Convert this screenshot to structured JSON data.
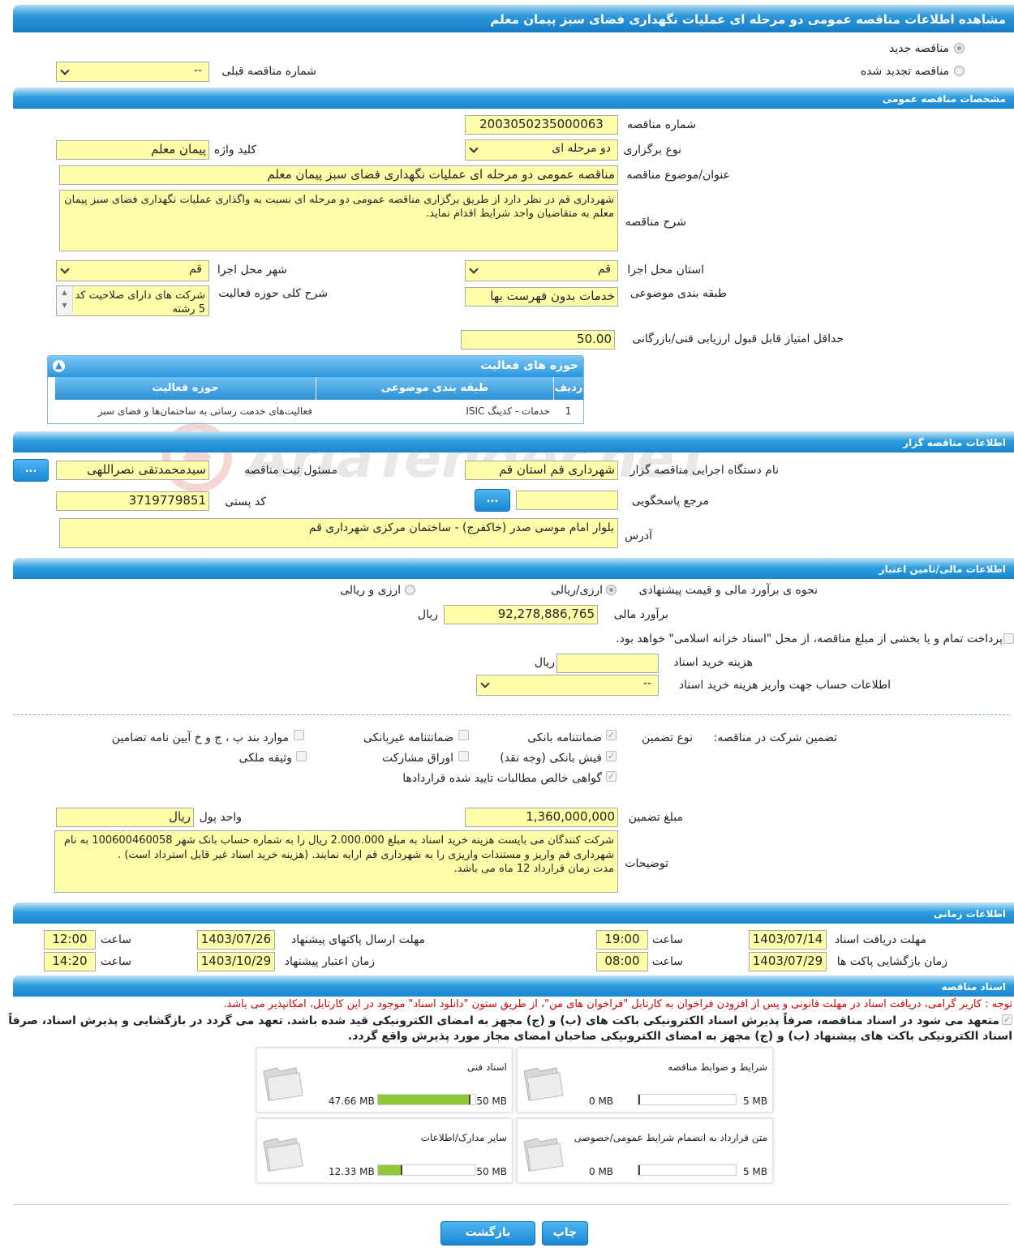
{
  "page_title": "مشاهده اطلاعات مناقصه عمومی دو مرحله ای عملیات نگهداری فضای سبز پیمان معلم",
  "tender_type": {
    "new_label": "مناقصه جدید",
    "renewed_label": "مناقصه تجدید شده",
    "previous_number_label": "شماره مناقصه قبلی",
    "previous_number_value": "--"
  },
  "general": {
    "section_title": "مشخصات مناقصه عمومی",
    "tender_number_label": "شماره مناقصه",
    "tender_number": "2003050235000063",
    "holding_type_label": "نوع برگزاری",
    "holding_type": "دو مرحله ای",
    "keyword_label": "کلید واژه",
    "keyword": "پیمان معلم",
    "subject_label": "عنوان/موضوع مناقصه",
    "subject": "مناقصه عمومی دو مرحله ای عملیات نگهداری فضای سبز پیمان معلم",
    "description_label": "شرح مناقصه",
    "description": "شهرداری قم در نظر دارد از طریق برگزاری مناقصه عمومی دو مرحله ای نسبت به واگذاری عملیات نگهداری فضای سبز پیمان معلم  به متقاضیان واجد شرایط اقدام نماید.",
    "province_label": "استان محل اجرا",
    "province": "قم",
    "city_label": "شهر محل اجرا",
    "city": "قم",
    "category_label": "طبقه بندی موضوعی",
    "category": "خدمات بدون فهرست بها",
    "activity_scope_label": "شرح کلی حوزه فعالیت",
    "activity_scope": "شرکت های دارای صلاحیت  کد 5 رشته",
    "min_score_label": "حداقل امتیاز قابل قبول ارزیابی فنی/بازرگانی",
    "min_score": "50.00"
  },
  "activity_table": {
    "title": "حوزه های فعالیت",
    "headers": [
      "ردیف",
      "طبقه بندی موضوعی",
      "حوزه فعالیت"
    ],
    "rows": [
      [
        "1",
        "خدمات - کدینگ ISIC",
        "فعالیت‌های خدمت رسانی به ساختمان‌ها و فضای سبز"
      ]
    ]
  },
  "organizer": {
    "section_title": "اطلاعات مناقصه گزار",
    "org_label": "نام دستگاه اجرایی مناقصه گزار",
    "org": "شهرداری قم استان قم",
    "registrar_label": "مسئول ثبت مناقصه",
    "registrar": "سیدمحمدتقی نصراللهی",
    "reference_label": "مرجع پاسخگویی",
    "reference": "",
    "postal_label": "کد پستی",
    "postal": "3719779851",
    "address_label": "آدرس",
    "address": "بلوار امام موسی صدر (خاکفرج) - ساختمان مرکزی شهرداری قم",
    "dots": "..."
  },
  "finance": {
    "section_title": "اطلاعات مالی/تامین اعتبار",
    "method_label": "نحوه ی برآورد مالی و قیمت پیشنهادی",
    "opt_rial": "ارزی/ریالی",
    "opt_fx": "ارزی و ریالی",
    "estimate_label": "برآورد مالی",
    "estimate": "92,278,886,765",
    "currency": "ریال",
    "treasury_text": "پرداخت تمام و یا بخشی از مبلغ مناقصه، از محل \"اسناد خزانه اسلامی\" خواهد بود.",
    "doc_cost_label": "هزینه خرید اسناد",
    "doc_cost": "",
    "doc_cost_unit": "ریال",
    "account_label": "اطلاعات حساب جهت واریز هزینه خرید اسناد",
    "account": "--"
  },
  "guarantee": {
    "title_label": "تضمین شرکت در مناقصه:",
    "type_label": "نوع تضمین",
    "options": [
      "ضمانتنامه بانکی",
      "ضمانتنامه غیربانکی",
      "موارد بند پ ، ج و خ آیین نامه تضامین",
      "فیش بانکی (وجه نقد)",
      "اوراق مشارکت",
      "وثیقه ملکی",
      "گواهی خالص مطالبات تایید شده قراردادها"
    ],
    "amount_label": "مبلغ تضمین",
    "amount": "1,360,000,000",
    "unit_label": "واحد پول",
    "unit": "ریال",
    "notes_label": "توضیحات",
    "notes": "شرکت کنندگان می بایست هزینه خرید اسناد به مبلغ 2.000.000 ریال را به شماره حساب بانک شهر 100600460058 به نام شهرداری قم واریز و مستندات واریزی را به شهرداری قم ارایه نمایند. (هزینه خرید اسناد غیر قابل استرداد است) .\nمدت زمان قرارداد 12 ماه می باشد."
  },
  "timing": {
    "section_title": "اطلاعات زمانی",
    "doc_deadline_label": "مهلت دریافت اسناد",
    "doc_deadline": "1403/07/14",
    "time_label": "ساعت",
    "doc_deadline_time": "19:00",
    "submit_deadline_label": "مهلت ارسال پاکتهای پیشنهاد",
    "submit_deadline": "1403/07/26",
    "submit_deadline_time": "12:00",
    "opening_label": "زمان بازگشایی پاکت ها",
    "opening": "1403/07/29",
    "opening_time": "08:00",
    "validity_label": "زمان اعتبار پیشنهاد",
    "validity": "1403/10/29",
    "validity_time": "14:20"
  },
  "documents": {
    "section_title": "اسناد مناقصه",
    "notice": "توجه : کاربر گرامی، دریافت اسناد در مهلت قانونی و پس از افزودن فراخوان به کارتابل \"فراخوان های من\"، از طریق ستون \"دانلود اسناد\" موجود در این کارتابل، امکانپذیر می باشد.",
    "commitment": "متعهد می شود در اسناد مناقصه، صرفاً پذیرش اسناد الکترونیکی باکت های (ب) و (ج) مجهز به امضای الکترونیکی قید شده باشد. تعهد می گردد در بازگشایی و پذیرش اسناد، صرفاً اسناد الکترونیکی باکت های پیشنهاد (ب) و (ج) مجهز به امضای الکترونیکی صاحبان امضای مجاز مورد پذیرش واقع گردد.",
    "tiles": [
      {
        "name": "شرایط و ضوابط مناقصه",
        "used": "0 MB",
        "max": "5 MB",
        "fill": 0
      },
      {
        "name": "اسناد فنی",
        "used": "47.66 MB",
        "max": "50 MB",
        "fill": 0.953
      },
      {
        "name": "متن قرارداد به انضمام شرایط عمومی/خصوصی",
        "used": "0 MB",
        "max": "5 MB",
        "fill": 0
      },
      {
        "name": "سایر مدارک/اطلاعات",
        "used": "12.33 MB",
        "max": "50 MB",
        "fill": 0.247
      }
    ]
  },
  "footer": {
    "print": "چاپ",
    "back": "بازگشت"
  },
  "watermark": "AriaTender.neT",
  "colors": {
    "accent": "#1986cf",
    "field": "#ffffaa",
    "progress": "#90c83a",
    "warning": "#d40000"
  }
}
